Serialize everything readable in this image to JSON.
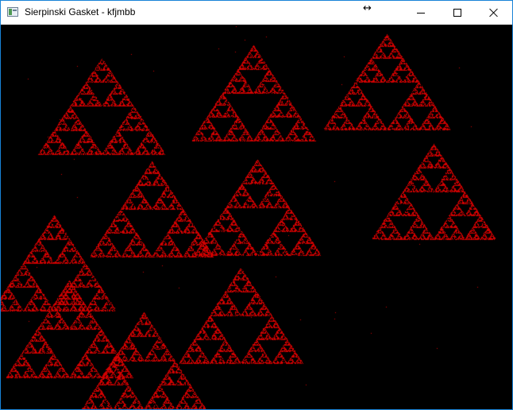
{
  "window": {
    "title": "Sierpinski Gasket - kfjmbb",
    "icon": "app-window-icon",
    "controls": [
      "minimize-icon",
      "maximize-icon",
      "close-icon"
    ],
    "cursor_glyph": "↔"
  },
  "canvas": {
    "background": "#000000",
    "point_color": "#d00000",
    "gasket_count": 12
  }
}
